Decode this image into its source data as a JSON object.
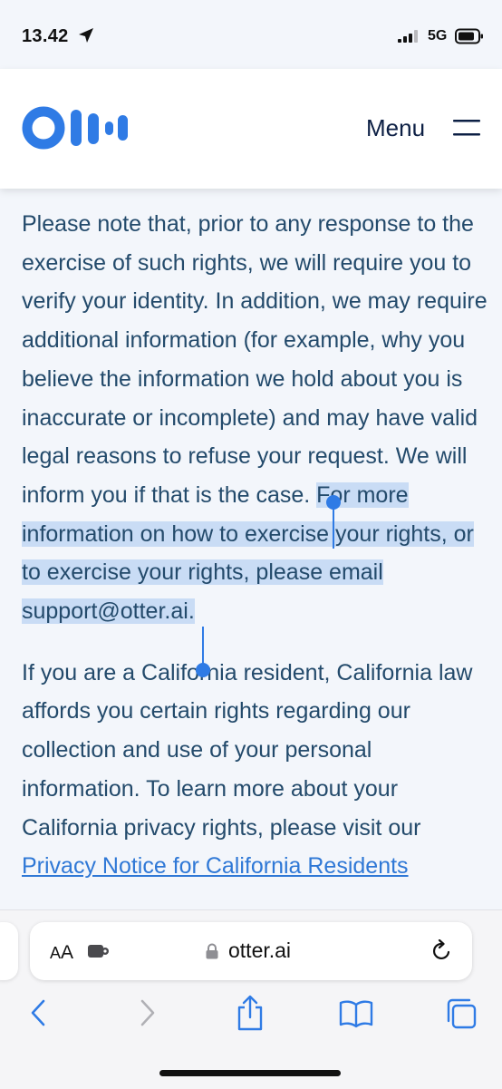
{
  "status_bar": {
    "time": "13.42",
    "network": "5G",
    "icons": [
      "location-arrow-icon",
      "signal-icon",
      "battery-icon"
    ]
  },
  "header": {
    "logo": "otter-logo",
    "menu_label": "Menu",
    "menu_icon": "hamburger-icon"
  },
  "article": {
    "p1_unselected": "Please note that, prior to any response to the exercise of such rights, we will require you to verify your identity. In addition, we may require additional information (for example, why you believe the information we hold about you is inaccurate or incomplete) and may have valid legal reasons to refuse your request. We will inform you if that is the case.",
    "p1_selected": "For more information on how to exercise your rights, or to exercise your rights, please email support@otter.ai.",
    "p2_text": "If you are a California resident, California law affords you certain rights regarding our collection and use of your personal information. To learn more about your California privacy rights, please visit our",
    "p2_link": "Privacy Notice for California Residents"
  },
  "safari": {
    "aa_small": "A",
    "aa_big": "A",
    "url": "otter.ai",
    "toolbar": [
      "back-icon",
      "forward-icon",
      "share-icon",
      "bookmarks-icon",
      "tabs-icon"
    ]
  },
  "colors": {
    "brand": "#2f7be5",
    "selection": "#c9dcf5",
    "text": "#234a6b",
    "link": "#2f78d6"
  }
}
